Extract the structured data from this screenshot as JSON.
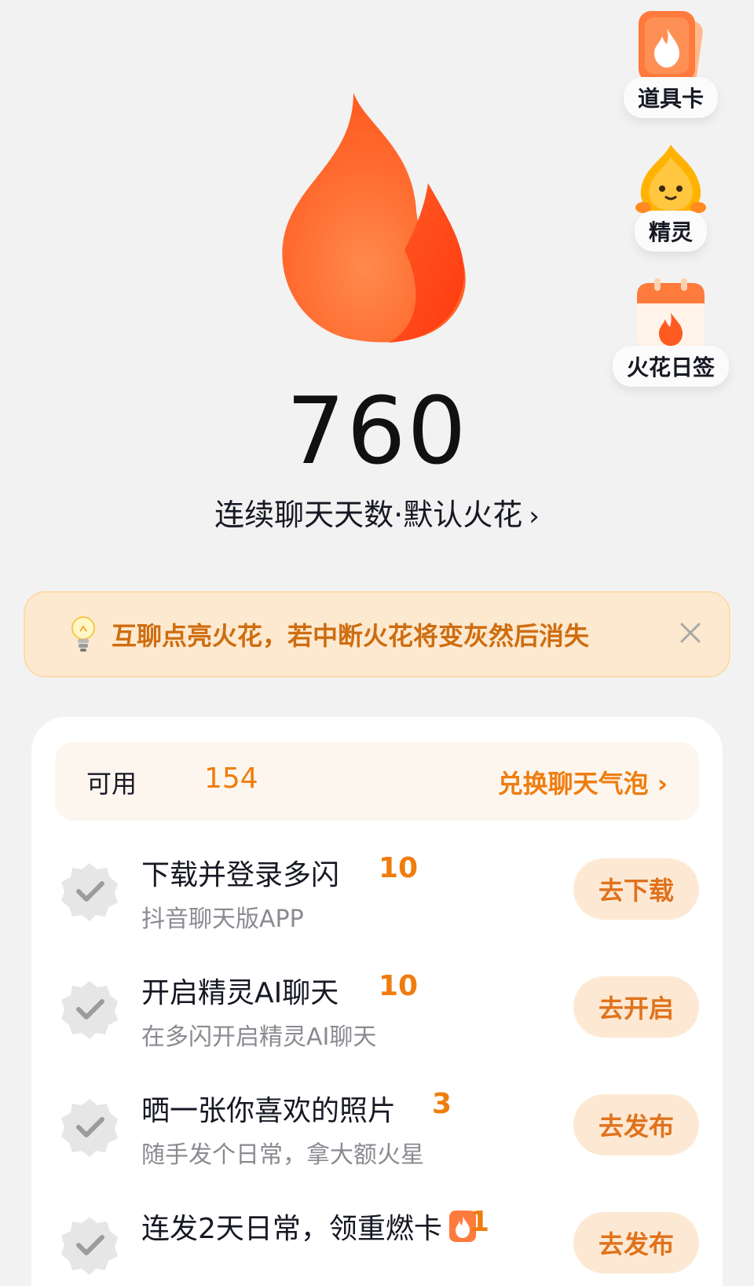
{
  "side_entries": {
    "cards": "道具卡",
    "sprite": "精灵",
    "sign": "火花日签"
  },
  "streak": {
    "number": "760",
    "caption": "连续聊天天数·默认火花"
  },
  "tip": {
    "text": "互聊点亮火花，若中断火花将变灰然后消失"
  },
  "available": {
    "label": "可用",
    "value": "154",
    "exchange_link": "兑换聊天气泡"
  },
  "tasks": [
    {
      "title": "下载并登录多闪",
      "reward": "10",
      "subtitle": "抖音聊天版APP",
      "button": "去下载"
    },
    {
      "title": "开启精灵AI聊天",
      "reward": "10",
      "subtitle": "在多闪开启精灵AI聊天",
      "button": "去开启"
    },
    {
      "title": "晒一张你喜欢的照片",
      "reward": "3",
      "subtitle": "随手发个日常，拿大额火星",
      "button": "去发布"
    },
    {
      "title": "连发2天日常，领重燃卡",
      "reward": "1",
      "subtitle": "",
      "button": "去发布"
    }
  ],
  "colors": {
    "accent_orange": "#ef7d0e",
    "tip_background": "#fde9cf",
    "button_background": "#fde9d3",
    "page_background": "#f2f2f2"
  },
  "icons": {
    "flame": "flame-icon",
    "card": "prop-card-icon",
    "sprite": "flame-sprite-icon",
    "calendar": "calendar-icon",
    "bulb": "lightbulb-icon",
    "close": "close-icon",
    "check": "check-badge-icon"
  }
}
